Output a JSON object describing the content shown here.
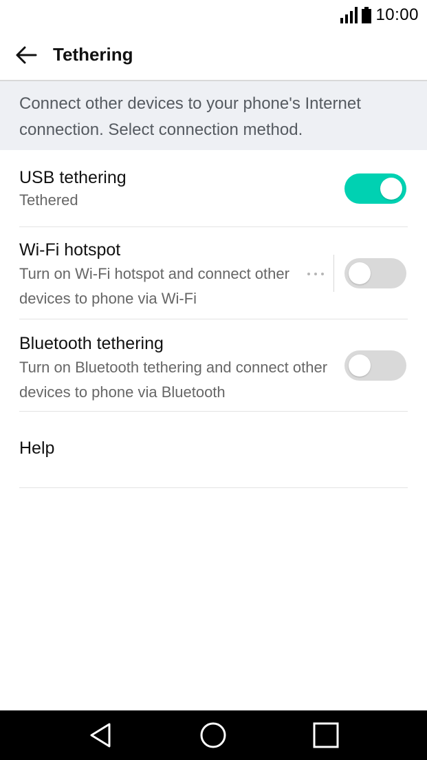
{
  "status_bar": {
    "time": "10:00",
    "icons": [
      "signal-icon",
      "battery-icon"
    ]
  },
  "header": {
    "title": "Tethering",
    "back_icon": "arrow-left-icon"
  },
  "description": "Connect other devices to your phone's Internet connection. Select connection method.",
  "items": [
    {
      "title": "USB tethering",
      "subtitle": "Tethered",
      "toggle_on": true
    },
    {
      "title": "Wi-Fi hotspot",
      "subtitle": "Turn on Wi-Fi hotspot and connect other devices to phone via Wi-Fi",
      "toggle_on": false,
      "more_icon": "more-horizontal-icon"
    },
    {
      "title": "Bluetooth tethering",
      "subtitle": "Turn on Bluetooth tethering and connect other devices to phone via Bluetooth",
      "toggle_on": false
    },
    {
      "title": "Help"
    }
  ],
  "colors": {
    "accent": "#00d1b2",
    "toggle_off": "#d9d9d9",
    "description_bg": "#eef0f4",
    "nav_bar": "#000000"
  },
  "nav_bar": {
    "icons": [
      "back-triangle-icon",
      "home-circle-icon",
      "recent-square-icon"
    ]
  }
}
